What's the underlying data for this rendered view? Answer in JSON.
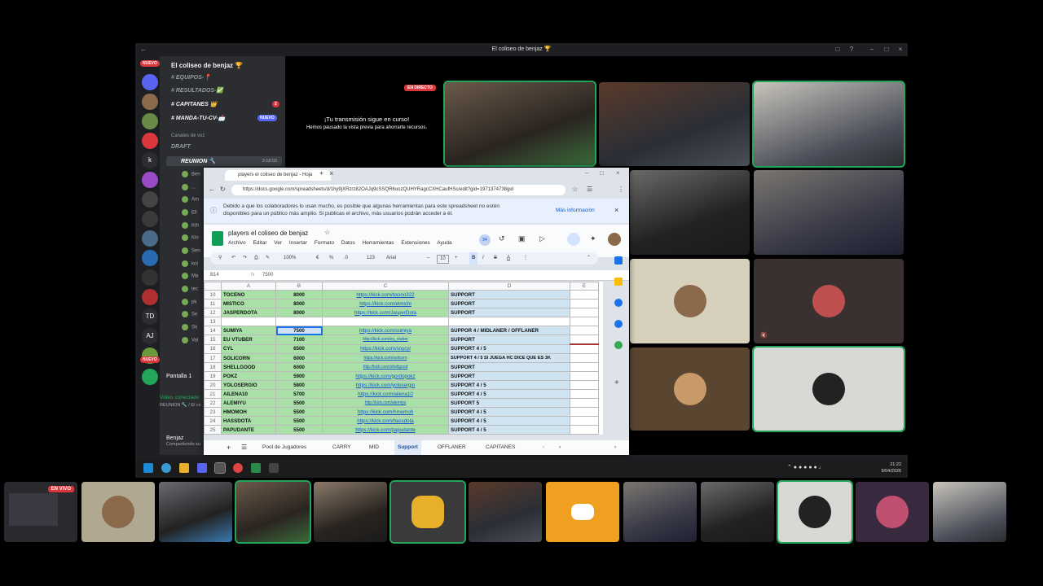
{
  "window": {
    "title": "El coliseo de benjaz 🏆"
  },
  "rail": {
    "nuevo_badge": "NUEVO",
    "nuevo_badge2": "NUEVO",
    "items": [
      "k",
      "TD",
      "AJ"
    ],
    "counts": [
      "7",
      "3",
      "13",
      "10",
      "19",
      "2"
    ]
  },
  "server": {
    "name": "El coliseo de benjaz 🏆"
  },
  "channels": [
    {
      "name": "EQUIPOS-📍"
    },
    {
      "name": "RESULTADOS-✅"
    },
    {
      "name": "CAPITANES 👑",
      "badge": "2"
    },
    {
      "name": "MANDA-TU-CV-📩",
      "badge": "NUEVO"
    }
  ],
  "voice": {
    "section": "Canales de voz",
    "draft": "DRAFT",
    "reunion": "REUNION 🔧",
    "timer": "3:18:03"
  },
  "voice_users": [
    "Ben",
    "...",
    "Am",
    "Ell",
    "Kth",
    "Kin",
    "Sen",
    "kot",
    "Ma",
    "tec",
    "pk",
    "Se",
    "Sti",
    "Val"
  ],
  "screen_share": {
    "label": "Pantalla 1",
    "sub": "Video conectado",
    "sub2": "REUNION 🔧 / El co"
  },
  "user": {
    "name": "Benjaz",
    "status": "Compartiendo su"
  },
  "stream": {
    "live_label": "EN DIRECTO",
    "paused_title": "¡Tu transmisión sigue en curso!",
    "paused_sub": "Hemos pausado la vista previa para ahorrarte recursos."
  },
  "browser": {
    "tab_title": "players el coliseo de benjaz - Hoja",
    "url": "https://docs.google.com/spreadsheets/d/1hy9jXRzrz82OAJq9cSSQR6oozQUHYRagcCXHCaufHSc/edit?gid=1971374738gid",
    "info_text": "Debido a que los colaboradores lo usan mucho, es posible que algunas herramientas para este spreadsheet no estén disponibles para un público más amplio. Si publicas el archivo, más usuarios podrán acceder a él.",
    "info_link": "Más información",
    "doc_title": "players el coliseo de benjaz",
    "menu": [
      "Archivo",
      "Editar",
      "Ver",
      "Insertar",
      "Formato",
      "Datos",
      "Herramientas",
      "Extensiones",
      "Ayuda"
    ],
    "zoom": "100%",
    "font": "Arial",
    "font_size": "10",
    "cell_ref": "B14",
    "formula": "7500",
    "col_headers": [
      "A",
      "B",
      "C",
      "D",
      "E"
    ],
    "rows": [
      {
        "n": "10",
        "a": "TOCENO",
        "b": "8000",
        "c": "https://kick.com/tocino322",
        "d": "SUPPORT"
      },
      {
        "n": "11",
        "a": "MISTICO",
        "b": "8000",
        "c": "https://kick.com/elmichi",
        "d": "SUPPORT"
      },
      {
        "n": "12",
        "a": "JASPERDOTA",
        "b": "8000",
        "c": "https://kick.com/JasperDota",
        "d": "SUPPORT"
      },
      {
        "n": "13",
        "a": "",
        "b": "",
        "c": "",
        "d": ""
      },
      {
        "n": "14",
        "a": "SUMIYA",
        "b": "7500",
        "c": "https://kick.com/sumiya",
        "d": "SUPPOR 4 / MIDLANER / OFFLANER"
      },
      {
        "n": "15",
        "a": "EU VTUBER",
        "b": "7100",
        "c": "http://kick.com/eu_vtuber",
        "d": "SUPPORT"
      },
      {
        "n": "16",
        "a": "CYL",
        "b": "6500",
        "c": "https://kick.com/soycyl",
        "d": "SUPPORT 4 / 5"
      },
      {
        "n": "17",
        "a": "SOLICORN",
        "b": "6000",
        "c": "https://kick.com/solicorn",
        "d": "SUPPORT 4 / 5 SI JUEGA HC DICE QUE ES 3K"
      },
      {
        "n": "18",
        "a": "SHELLGOOD",
        "b": "6000",
        "c": "http://kick.com/shellgood",
        "d": "SUPPORT"
      },
      {
        "n": "19",
        "a": "POKZ",
        "b": "5900",
        "c": "https://kick.com/gordopokz",
        "d": "SUPPORT"
      },
      {
        "n": "20",
        "a": "YOLOSERGIO",
        "b": "5800",
        "c": "https://kick.com/yolosergio",
        "d": "SUPPORT 4 / 5"
      },
      {
        "n": "21",
        "a": "AILENA10",
        "b": "5700",
        "c": "https://kick.com/ailena10",
        "d": "SUPPORT 4 / 5"
      },
      {
        "n": "22",
        "a": "ALEMIYU",
        "b": "5500",
        "c": "http://kick.com/alemiyu",
        "d": "SUPPORT 5"
      },
      {
        "n": "23",
        "a": "HMOMOH",
        "b": "5500",
        "c": "https://kick.com/hmomoh",
        "d": "SUPPORT 4 / 5"
      },
      {
        "n": "24",
        "a": "HASSDOTA",
        "b": "5500",
        "c": "https://kick.com/hassdota",
        "d": "SUPPORT 4 / 5"
      },
      {
        "n": "25",
        "a": "PAPUDANTE",
        "b": "5500",
        "c": "https://kick.com/papudante",
        "d": "SUPPORT 4 / 5"
      }
    ],
    "sheet_tabs": [
      "Pool de Jugadores",
      "CARRY",
      "MID",
      "Support",
      "OFFLANER",
      "CAPITANES"
    ],
    "active_tab": "Support"
  },
  "taskbar": {
    "time": "21:22",
    "date": "9/04/2026"
  },
  "strip": {
    "live_label": "EN VIVO"
  },
  "colors": {
    "accent_green": "#23a55a",
    "live_red": "#da373c",
    "sheet_green": "#a8e0a8",
    "sheet_blue": "#cfe3f0",
    "link_blue": "#1155cc"
  }
}
